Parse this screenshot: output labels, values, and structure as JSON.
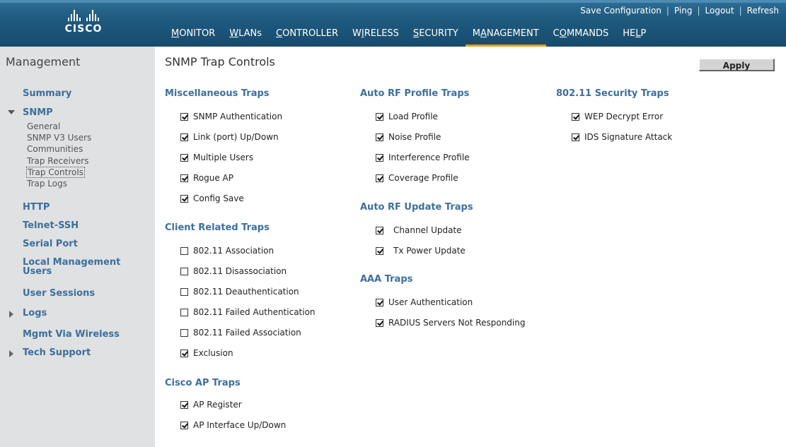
{
  "header": {
    "logo_text": "CISCO",
    "utility_links": [
      "Save Configuration",
      "Ping",
      "Logout",
      "Refresh"
    ],
    "nav": [
      {
        "label": "MONITOR",
        "ul": "M",
        "active": false
      },
      {
        "label": "WLANs",
        "ul": "W",
        "active": false
      },
      {
        "label": "CONTROLLER",
        "ul": "C",
        "active": false
      },
      {
        "label": "WIRELESS",
        "ul": "I",
        "active": false
      },
      {
        "label": "SECURITY",
        "ul": "S",
        "active": false
      },
      {
        "label": "MANAGEMENT",
        "ul": "A",
        "active": true
      },
      {
        "label": "COMMANDS",
        "ul": "O",
        "active": false
      },
      {
        "label": "HELP",
        "ul": "L",
        "active": false
      }
    ],
    "accent_color": "#f39c12",
    "bar_color": "#1f5a80"
  },
  "sidebar": {
    "title": "Management",
    "summary": "Summary",
    "snmp": "SNMP",
    "snmp_items": [
      "General",
      "SNMP V3 Users",
      "Communities",
      "Trap Receivers",
      "Trap Controls",
      "Trap Logs"
    ],
    "selected_item": "Trap Controls",
    "http": "HTTP",
    "telnet": "Telnet-SSH",
    "serial": "Serial Port",
    "local_mgmt_1": "Local Management",
    "local_mgmt_2": "Users",
    "user_sessions": "User Sessions",
    "logs": "Logs",
    "mgmt_wireless": "Mgmt Via Wireless",
    "tech_support": "Tech Support"
  },
  "main": {
    "title": "SNMP Trap Controls",
    "apply_label": "Apply",
    "misc": {
      "heading": "Miscellaneous Traps",
      "items": [
        {
          "label": "SNMP Authentication",
          "checked": true
        },
        {
          "label": "Link (port) Up/Down",
          "checked": true
        },
        {
          "label": "Multiple Users",
          "checked": true
        },
        {
          "label": "Rogue AP",
          "checked": true
        },
        {
          "label": "Config Save",
          "checked": true
        }
      ]
    },
    "client": {
      "heading": "Client Related Traps",
      "items": [
        {
          "label": "802.11 Association",
          "checked": false
        },
        {
          "label": "802.11 Disassociation",
          "checked": false
        },
        {
          "label": "802.11 Deauthentication",
          "checked": false
        },
        {
          "label": "802.11 Failed Authentication",
          "checked": false
        },
        {
          "label": "802.11 Failed Association",
          "checked": false
        },
        {
          "label": "Exclusion",
          "checked": true
        }
      ]
    },
    "ap": {
      "heading": "Cisco AP Traps",
      "items": [
        {
          "label": "AP Register",
          "checked": true
        },
        {
          "label": "AP Interface Up/Down",
          "checked": true
        }
      ]
    },
    "rf_profile": {
      "heading": "Auto RF Profile Traps",
      "items": [
        {
          "label": "Load Profile",
          "checked": true
        },
        {
          "label": "Noise Profile",
          "checked": true
        },
        {
          "label": "Interference Profile",
          "checked": true
        },
        {
          "label": "Coverage Profile",
          "checked": true
        }
      ]
    },
    "rf_update": {
      "heading": "Auto RF Update Traps",
      "items": [
        {
          "label": "Channel Update",
          "checked": true
        },
        {
          "label": "Tx Power Update",
          "checked": true
        }
      ]
    },
    "aaa": {
      "heading": "AAA Traps",
      "items": [
        {
          "label": "User Authentication",
          "checked": true
        },
        {
          "label": "RADIUS Servers Not Responding",
          "checked": true
        }
      ]
    },
    "security": {
      "heading": "802.11 Security Traps",
      "items": [
        {
          "label": "WEP Decrypt Error",
          "checked": true
        },
        {
          "label": "IDS Signature Attack",
          "checked": true
        }
      ]
    }
  }
}
